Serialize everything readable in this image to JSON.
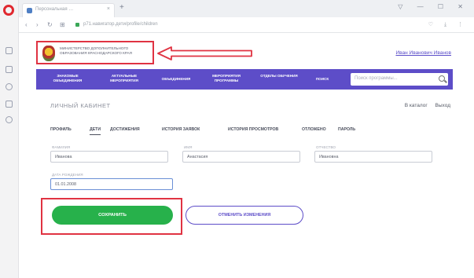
{
  "browser": {
    "tab_title": "Персональная … ",
    "tab_close": "×",
    "new_tab": "+",
    "window_controls": "▽ — ☐ ✕",
    "nav_back": "‹",
    "nav_forward": "›",
    "nav_reload": "↻",
    "nav_grid": "⊞",
    "url": "р71.навигатор.дети/profile/children",
    "bar_icons": "♡ ⤓ ⋮"
  },
  "header": {
    "org_name": "Министерство дополнительного образования Краснодарского края",
    "user_link": "Иван Иванович Иванов"
  },
  "main_nav": {
    "items": [
      "Знакомые объединения",
      "Актуальные мероприятия",
      "Объединения",
      "Мероприятия программы",
      "Отделы обучения",
      "Поиск"
    ],
    "search_placeholder": "Поиск программы..."
  },
  "cabinet": {
    "title": "Личный кабинет",
    "link_catalog": "В каталог",
    "link_exit": "Выход"
  },
  "profile_tabs": [
    "Профиль",
    "Дети",
    "Достижения",
    "История заявок",
    "История просмотров",
    "Отложено",
    "Пароль"
  ],
  "form": {
    "lastname_label": "Фамилия",
    "lastname_value": "Иванова",
    "firstname_label": "Имя",
    "firstname_value": "Анастасия",
    "patronymic_label": "Отчество",
    "patronymic_value": "Ивановна",
    "birthdate_label": "Дата рождения",
    "birthdate_value": "01.01.2008"
  },
  "actions": {
    "save_label": "Сохранить",
    "cancel_label": "Отменить изменения"
  },
  "colors": {
    "nav_purple": "#5d4dc8",
    "save_green": "#27b14b",
    "highlight_red": "#e03342"
  }
}
